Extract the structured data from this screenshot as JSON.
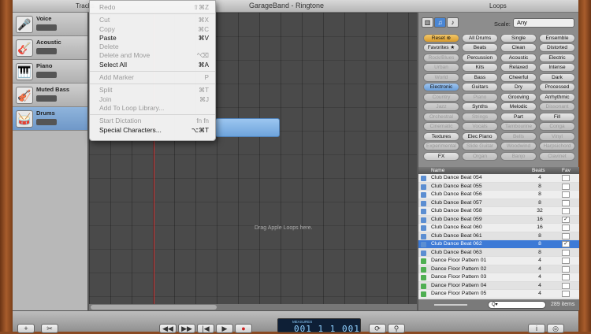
{
  "window": {
    "title": "GarageBand - Ringtone",
    "tracks_header": "Tracks",
    "loops_header": "Loops"
  },
  "tracks": [
    {
      "name": "Voice",
      "icon": "microphone-icon"
    },
    {
      "name": "Acoustic",
      "icon": "guitar-icon"
    },
    {
      "name": "Piano",
      "icon": "piano-icon"
    },
    {
      "name": "Muted Bass",
      "icon": "bass-icon"
    },
    {
      "name": "Drums",
      "icon": "drums-icon"
    }
  ],
  "timeline": {
    "drag_hint": "Drag Apple Loops here."
  },
  "edit_menu": {
    "items": [
      {
        "label": "Redo",
        "shortcut": "⇧⌘Z",
        "enabled": false
      },
      {
        "sep": true
      },
      {
        "label": "Cut",
        "shortcut": "⌘X",
        "enabled": false
      },
      {
        "label": "Copy",
        "shortcut": "⌘C",
        "enabled": false
      },
      {
        "label": "Paste",
        "shortcut": "⌘V",
        "enabled": true
      },
      {
        "label": "Delete",
        "shortcut": "",
        "enabled": false
      },
      {
        "label": "Delete and Move",
        "shortcut": "^⌫",
        "enabled": false
      },
      {
        "label": "Select All",
        "shortcut": "⌘A",
        "enabled": true
      },
      {
        "sep": true
      },
      {
        "label": "Add Marker",
        "shortcut": "P",
        "enabled": false
      },
      {
        "sep": true
      },
      {
        "label": "Split",
        "shortcut": "⌘T",
        "enabled": false
      },
      {
        "label": "Join",
        "shortcut": "⌘J",
        "enabled": false
      },
      {
        "label": "Add To Loop Library...",
        "shortcut": "",
        "enabled": false
      },
      {
        "sep": true
      },
      {
        "label": "Start Dictation",
        "shortcut": "fn fn",
        "enabled": false
      },
      {
        "label": "Special Characters...",
        "shortcut": "⌥⌘T",
        "enabled": true
      }
    ]
  },
  "loops": {
    "scale_label": "Scale:",
    "scale_value": "Any",
    "keywords": [
      {
        "label": "Reset ⊗",
        "state": "reset"
      },
      {
        "label": "All Drums",
        "state": "normal"
      },
      {
        "label": "Single",
        "state": "normal"
      },
      {
        "label": "Ensemble",
        "state": "normal"
      },
      {
        "label": "Favorites ★",
        "state": "normal"
      },
      {
        "label": "Beats",
        "state": "normal"
      },
      {
        "label": "Clean",
        "state": "normal"
      },
      {
        "label": "Distorted",
        "state": "normal"
      },
      {
        "label": "Rock/Blues",
        "state": "dim"
      },
      {
        "label": "Percussion",
        "state": "normal"
      },
      {
        "label": "Acoustic",
        "state": "normal"
      },
      {
        "label": "Electric",
        "state": "normal"
      },
      {
        "label": "Urban",
        "state": "dim"
      },
      {
        "label": "Kits",
        "state": "normal"
      },
      {
        "label": "Relaxed",
        "state": "normal"
      },
      {
        "label": "Intense",
        "state": "normal"
      },
      {
        "label": "World",
        "state": "dim"
      },
      {
        "label": "Bass",
        "state": "normal"
      },
      {
        "label": "Cheerful",
        "state": "normal"
      },
      {
        "label": "Dark",
        "state": "normal"
      },
      {
        "label": "Electronic",
        "state": "selected"
      },
      {
        "label": "Guitars",
        "state": "normal"
      },
      {
        "label": "Dry",
        "state": "normal"
      },
      {
        "label": "Processed",
        "state": "normal"
      },
      {
        "label": "Country",
        "state": "dim"
      },
      {
        "label": "Piano",
        "state": "dim"
      },
      {
        "label": "Grooving",
        "state": "normal"
      },
      {
        "label": "Arrhythmic",
        "state": "normal"
      },
      {
        "label": "Jazz",
        "state": "dim"
      },
      {
        "label": "Synths",
        "state": "normal"
      },
      {
        "label": "Melodic",
        "state": "normal"
      },
      {
        "label": "Dissonant",
        "state": "dim"
      },
      {
        "label": "Orchestral",
        "state": "dim"
      },
      {
        "label": "Strings",
        "state": "dim"
      },
      {
        "label": "Part",
        "state": "normal"
      },
      {
        "label": "Fill",
        "state": "normal"
      },
      {
        "label": "Cinematic",
        "state": "dim"
      },
      {
        "label": "Vocals",
        "state": "dim"
      },
      {
        "label": "Tambourine",
        "state": "dim"
      },
      {
        "label": "Conga",
        "state": "dim"
      },
      {
        "label": "Textures",
        "state": "normal"
      },
      {
        "label": "Elec Piano",
        "state": "normal"
      },
      {
        "label": "Bells",
        "state": "dim"
      },
      {
        "label": "Vinyl",
        "state": "dim"
      },
      {
        "label": "Experimental",
        "state": "dim"
      },
      {
        "label": "Slide Guitar",
        "state": "dim"
      },
      {
        "label": "Woodwind",
        "state": "dim"
      },
      {
        "label": "Harpsichord",
        "state": "dim"
      },
      {
        "label": "FX",
        "state": "normal"
      },
      {
        "label": "Organ",
        "state": "dim"
      },
      {
        "label": "Banjo",
        "state": "dim"
      },
      {
        "label": "Clavinet",
        "state": "dim"
      }
    ],
    "columns": {
      "name": "Name",
      "beats": "Beats",
      "fav": "Fav"
    },
    "results": [
      {
        "name": "Club Dance Beat 054",
        "beats": "4",
        "fav": "",
        "type": "blue"
      },
      {
        "name": "Club Dance Beat 055",
        "beats": "8",
        "fav": "",
        "type": "blue"
      },
      {
        "name": "Club Dance Beat 056",
        "beats": "8",
        "fav": "",
        "type": "blue"
      },
      {
        "name": "Club Dance Beat 057",
        "beats": "8",
        "fav": "",
        "type": "blue"
      },
      {
        "name": "Club Dance Beat 058",
        "beats": "32",
        "fav": "",
        "type": "blue"
      },
      {
        "name": "Club Dance Beat 059",
        "beats": "16",
        "fav": "✓",
        "type": "blue"
      },
      {
        "name": "Club Dance Beat 060",
        "beats": "16",
        "fav": "",
        "type": "blue"
      },
      {
        "name": "Club Dance Beat 061",
        "beats": "8",
        "fav": "",
        "type": "blue"
      },
      {
        "name": "Club Dance Beat 062",
        "beats": "8",
        "fav": "✓",
        "type": "blue",
        "selected": true
      },
      {
        "name": "Club Dance Beat 063",
        "beats": "8",
        "fav": "",
        "type": "blue"
      },
      {
        "name": "Dance Floor Pattern 01",
        "beats": "4",
        "fav": "",
        "type": "green"
      },
      {
        "name": "Dance Floor Pattern 02",
        "beats": "4",
        "fav": "",
        "type": "green"
      },
      {
        "name": "Dance Floor Pattern 03",
        "beats": "4",
        "fav": "",
        "type": "green"
      },
      {
        "name": "Dance Floor Pattern 04",
        "beats": "4",
        "fav": "",
        "type": "green"
      },
      {
        "name": "Dance Floor Pattern 05",
        "beats": "4",
        "fav": "",
        "type": "green"
      }
    ],
    "item_count": "289 items",
    "search_placeholder": "Q▾"
  },
  "transport": {
    "display_label": "MEASURES",
    "display_value": "001 1 1 001"
  }
}
